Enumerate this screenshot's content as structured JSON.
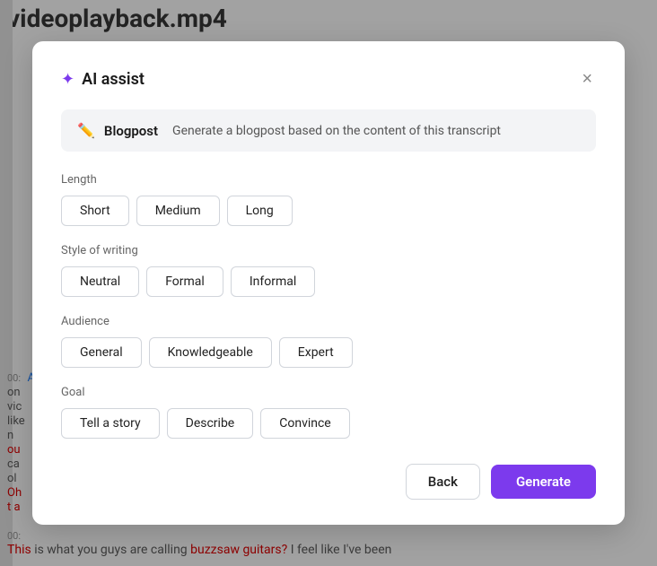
{
  "background": {
    "title": "videoplayback.mp4",
    "bottom_text": "This is what you guys are calling ",
    "bottom_link": "buzzsaw guitars?",
    "bottom_rest": " I feel like I've been"
  },
  "modal": {
    "title": "AI assist",
    "close_label": "×",
    "blogpost": {
      "label": "Blogpost",
      "description": "Generate a blogpost based on the content of this transcript"
    },
    "length": {
      "label": "Length",
      "options": [
        "Short",
        "Medium",
        "Long"
      ]
    },
    "style": {
      "label": "Style of writing",
      "options": [
        "Neutral",
        "Formal",
        "Informal"
      ]
    },
    "audience": {
      "label": "Audience",
      "options": [
        "General",
        "Knowledgeable",
        "Expert"
      ]
    },
    "goal": {
      "label": "Goal",
      "options": [
        "Tell a story",
        "Describe",
        "Convince"
      ]
    },
    "footer": {
      "back_label": "Back",
      "generate_label": "Generate"
    }
  }
}
